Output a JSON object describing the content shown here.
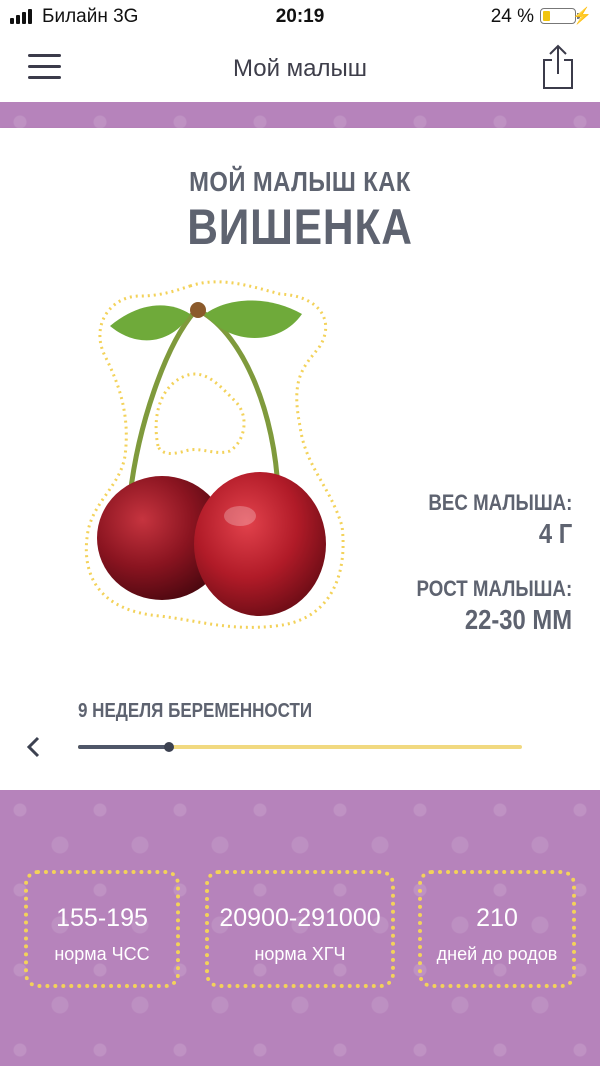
{
  "status": {
    "carrier": "Билайн   3G",
    "time": "20:19",
    "battery": "24 %",
    "battery_level": 0.24
  },
  "nav": {
    "title": "Мой малыш",
    "menu_icon": "hamburger-icon",
    "share_icon": "share-icon"
  },
  "hero": {
    "subtitle": "МОЙ МАЛЫШ КАК",
    "fruit_name": "ВИШЕНКА",
    "image": "cherry-illustration"
  },
  "stats": {
    "weight_label": "ВЕС МАЛЫША:",
    "weight_value": "4 Г",
    "height_label": "РОСТ МАЛЫША:",
    "height_value": "22-30 ММ"
  },
  "week": {
    "label": "9 НЕДЕЛЯ БЕРЕМЕННОСТИ",
    "progress": 0.205
  },
  "info": [
    {
      "value": "155-195",
      "label": "норма ЧСС"
    },
    {
      "value": "20900-291000",
      "label": "норма ХГЧ"
    },
    {
      "value": "210",
      "label": "дней до родов"
    }
  ],
  "colors": {
    "accent_purple": "#b683bb",
    "dotted_yellow": "#f3d25a",
    "text_gray": "#5e6370"
  }
}
